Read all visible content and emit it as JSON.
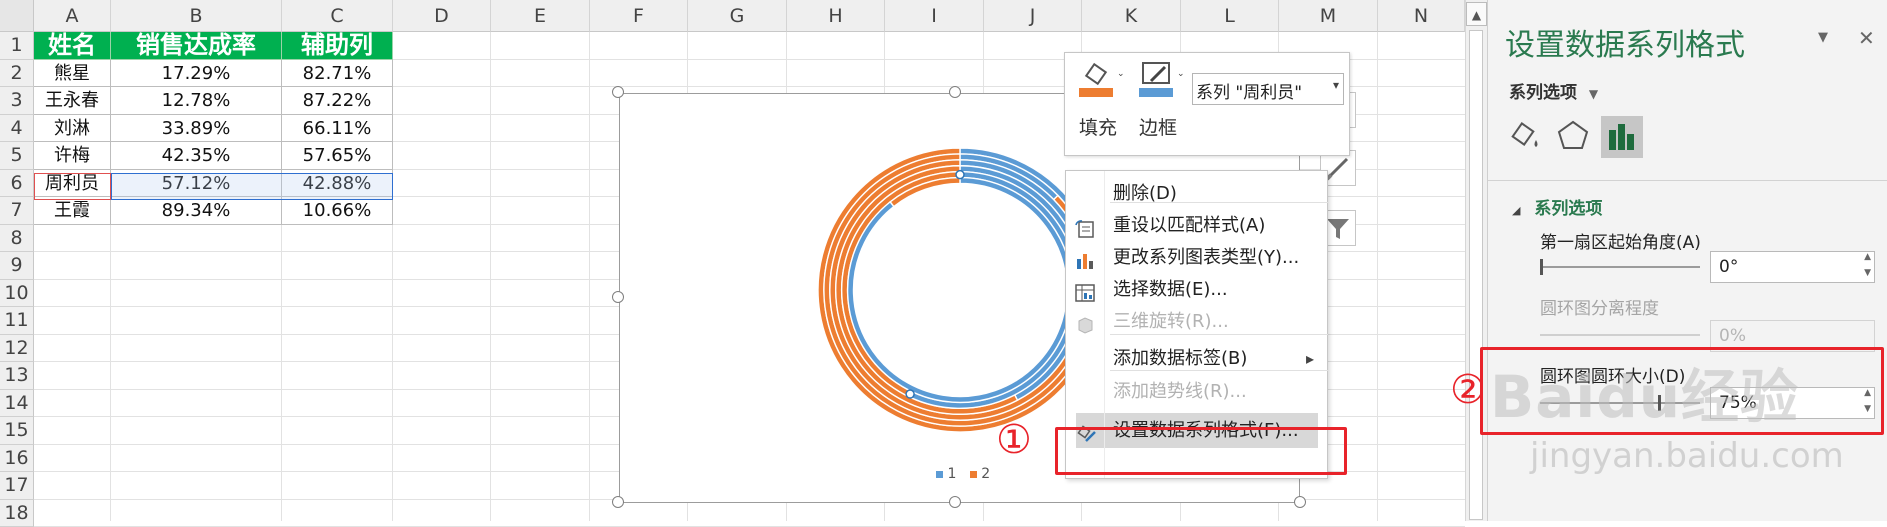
{
  "columns": [
    "A",
    "B",
    "C",
    "D",
    "E",
    "F",
    "G",
    "H",
    "I",
    "J",
    "K",
    "L",
    "M",
    "N"
  ],
  "rows": [
    "1",
    "2",
    "3",
    "4",
    "5",
    "6",
    "7",
    "8",
    "9",
    "10",
    "11",
    "12",
    "13",
    "14",
    "15",
    "16",
    "17",
    "18"
  ],
  "table": {
    "headers": [
      "姓名",
      "销售达成率",
      "辅助列"
    ],
    "data": [
      [
        "熊星",
        "17.29%",
        "82.71%"
      ],
      [
        "王永春",
        "12.78%",
        "87.22%"
      ],
      [
        "刘淋",
        "33.89%",
        "66.11%"
      ],
      [
        "许梅",
        "42.35%",
        "57.65%"
      ],
      [
        "周利员",
        "57.12%",
        "42.88%"
      ],
      [
        "王霞",
        "89.34%",
        "10.66%"
      ]
    ]
  },
  "chart_data": {
    "type": "doughnut",
    "rings": [
      {
        "label": "熊星",
        "values": [
          17.29,
          82.71
        ]
      },
      {
        "label": "王永春",
        "values": [
          12.78,
          87.22
        ]
      },
      {
        "label": "刘淋",
        "values": [
          33.89,
          66.11
        ]
      },
      {
        "label": "许梅",
        "values": [
          42.35,
          57.65
        ]
      },
      {
        "label": "周利员",
        "values": [
          57.12,
          42.88
        ]
      },
      {
        "label": "王霞",
        "values": [
          89.34,
          10.66
        ]
      }
    ],
    "legend": [
      "1",
      "2"
    ],
    "colors": {
      "1": "#5b9bd5",
      "2": "#ed7d31"
    },
    "legend_position": "bottom"
  },
  "mini_toolbar": {
    "fill_label": "填充",
    "border_label": "边框",
    "series_select": "系列 \"周利员\""
  },
  "context_menu": [
    {
      "label": "删除(D)",
      "enabled": true,
      "icon": ""
    },
    {
      "label": "重设以匹配样式(A)",
      "enabled": true,
      "icon": "reset-style-icon"
    },
    {
      "label": "更改系列图表类型(Y)...",
      "enabled": true,
      "icon": "change-chart-type-icon"
    },
    {
      "label": "选择数据(E)...",
      "enabled": true,
      "icon": "select-data-icon"
    },
    {
      "label": "三维旋转(R)...",
      "enabled": false,
      "icon": "3d-rotation-icon"
    },
    {
      "label": "添加数据标签(B)",
      "enabled": true,
      "icon": "",
      "submenu": true
    },
    {
      "label": "添加趋势线(R)...",
      "enabled": false,
      "icon": ""
    },
    {
      "label": "设置数据系列格式(F)...",
      "enabled": true,
      "icon": "format-series-icon",
      "highlighted": true
    }
  ],
  "pane": {
    "title": "设置数据系列格式",
    "options_label": "系列选项",
    "section_title": "系列选项",
    "first_angle_label": "第一扇区起始角度(A)",
    "first_angle_value": "0°",
    "first_angle_level": 0,
    "explosion_label": "圆环图分离程度",
    "explosion_value": "0%",
    "hole_size_label": "圆环图圆环大小(D)",
    "hole_size_value": "75%"
  },
  "annotations": {
    "step1": "①",
    "step2": "②"
  },
  "watermark": {
    "brand": "Baidu经验",
    "url": "jingyan.baidu.com"
  }
}
